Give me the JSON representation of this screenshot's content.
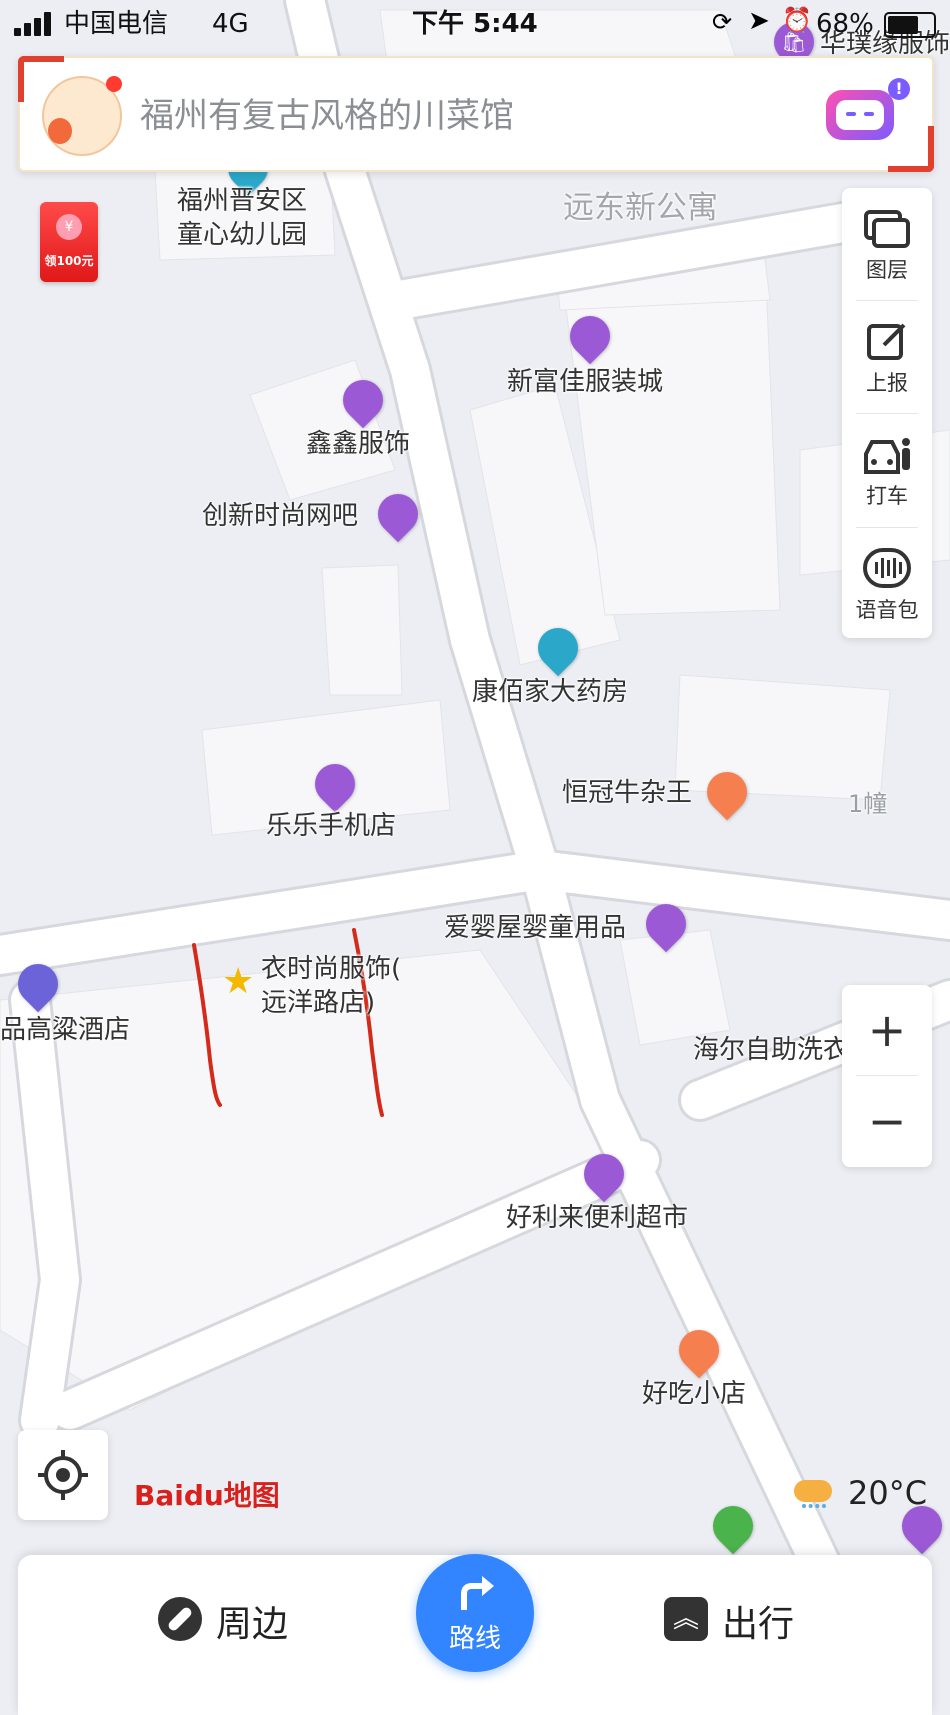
{
  "status_bar": {
    "carrier": "中国电信",
    "network": "4G",
    "time": "下午 5:44",
    "battery": "68%"
  },
  "search": {
    "placeholder": "福州有复古风格的川菜馆"
  },
  "red_packet": {
    "label": "领100元"
  },
  "side_panel": {
    "items": [
      {
        "label": "图层",
        "icon": "layers-icon"
      },
      {
        "label": "上报",
        "icon": "report-icon"
      },
      {
        "label": "打车",
        "icon": "taxi-icon"
      },
      {
        "label": "语音包",
        "icon": "voice-pack-icon"
      }
    ]
  },
  "map": {
    "area_labels": [
      {
        "text": "远东新公寓"
      },
      {
        "text": "1幢"
      }
    ],
    "pois": [
      {
        "name": "华璞缘服饰",
        "category": "shopping",
        "color": "#9b59d6"
      },
      {
        "name": "福州晋安区\n童心幼儿园",
        "category": "school",
        "color": "#2aa7c9"
      },
      {
        "name": "新富佳服装城",
        "category": "shopping",
        "color": "#9b59d6"
      },
      {
        "name": "鑫鑫服饰",
        "category": "shopping",
        "color": "#9b59d6"
      },
      {
        "name": "创新时尚网吧",
        "category": "entertainment",
        "color": "#9b59d6"
      },
      {
        "name": "康佰家大药房",
        "category": "pharmacy",
        "color": "#2aa7c9"
      },
      {
        "name": "乐乐手机店",
        "category": "shopping",
        "color": "#9b59d6"
      },
      {
        "name": "恒冠牛杂王",
        "category": "food",
        "color": "#f57f4f"
      },
      {
        "name": "爱婴屋婴童用品",
        "category": "shopping",
        "color": "#9b59d6"
      },
      {
        "name": "衣时尚服饰(\n远洋路店)",
        "category": "favorite",
        "color": "#f5b800"
      },
      {
        "name": "品高粱酒店",
        "category": "hotel",
        "color": "#6c63d9"
      },
      {
        "name": "海尔自助洗衣",
        "category": "service",
        "color": "#2aa7c9"
      },
      {
        "name": "好利来便利超市",
        "category": "supermarket",
        "color": "#9b59d6"
      },
      {
        "name": "好吃小店",
        "category": "food",
        "color": "#f57f4f"
      }
    ]
  },
  "weather": {
    "temperature": "20°C",
    "icon": "cloud-rain-icon"
  },
  "logo": {
    "brand_text": "Baidu地图"
  },
  "bottom_bar": {
    "nearby_label": "周边",
    "route_label": "路线",
    "travel_label": "出行"
  },
  "colors": {
    "accent": "#3385ff",
    "annotation_stroke": "#d42a1a"
  }
}
